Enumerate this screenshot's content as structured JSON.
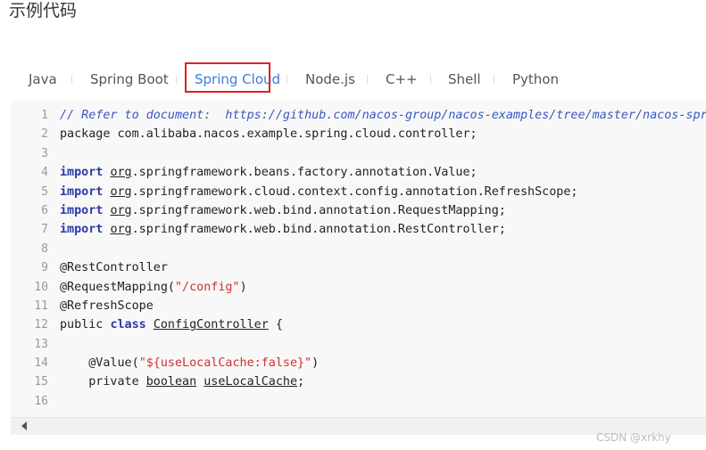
{
  "page": {
    "heading": "示例代码"
  },
  "tabs": [
    {
      "label": "Java",
      "active": false
    },
    {
      "label": "Spring Boot",
      "active": false
    },
    {
      "label": "Spring Cloud",
      "active": true
    },
    {
      "label": "Node.js",
      "active": false
    },
    {
      "label": "C++",
      "active": false
    },
    {
      "label": "Shell",
      "active": false
    },
    {
      "label": "Python",
      "active": false
    }
  ],
  "code": {
    "line_numbers": [
      "1",
      "2",
      "3",
      "4",
      "5",
      "6",
      "7",
      "8",
      "9",
      "10",
      "11",
      "12",
      "13",
      "14",
      "15",
      "16"
    ],
    "lines": [
      "// Refer to document:  https://github.com/nacos-group/nacos-examples/tree/master/nacos-spri",
      "package com.alibaba.nacos.example.spring.cloud.controller;",
      "",
      "import org.springframework.beans.factory.annotation.Value;",
      "import org.springframework.cloud.context.config.annotation.RefreshScope;",
      "import org.springframework.web.bind.annotation.RequestMapping;",
      "import org.springframework.web.bind.annotation.RestController;",
      "",
      "@RestController",
      "@RequestMapping(\"/config\")",
      "@RefreshScope",
      "public class ConfigController {",
      "",
      "    @Value(\"${useLocalCache:false}\")",
      "    private boolean useLocalCache;",
      ""
    ]
  },
  "colors": {
    "active_tab": "#3e7bdb",
    "highlight_border": "#e02020",
    "comment": "#3a57c0",
    "keyword": "#2a3aa8",
    "string": "#d12f2f"
  },
  "watermark": "CSDN @xrkhy"
}
